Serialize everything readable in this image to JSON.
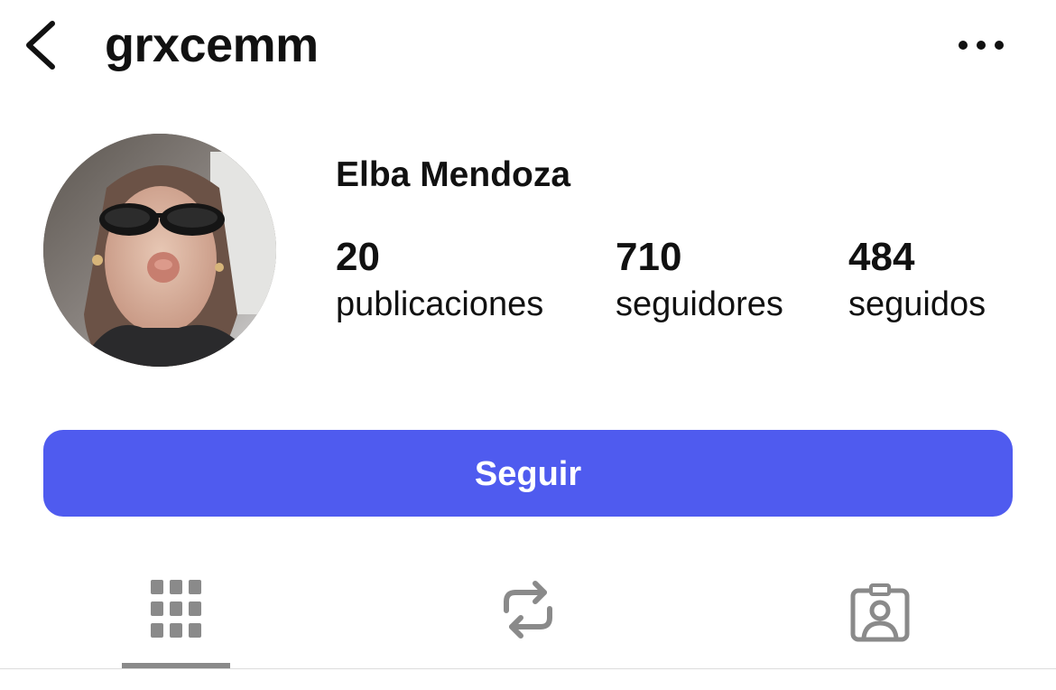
{
  "header": {
    "back_icon": "chevron-left-icon",
    "username": "grxcemm",
    "more_icon": "more-horizontal-icon"
  },
  "profile": {
    "display_name": "Elba Mendoza",
    "avatar": "profile-photo-avatar"
  },
  "stats": [
    {
      "count": "20",
      "label": "publicaciones"
    },
    {
      "count": "710",
      "label": "seguidores"
    },
    {
      "count": "484",
      "label": "seguidos"
    }
  ],
  "actions": {
    "follow_label": "Seguir",
    "follow_color": "#4f5bef"
  },
  "tabs": [
    {
      "icon": "grid-icon",
      "active": true
    },
    {
      "icon": "repost-icon",
      "active": false
    },
    {
      "icon": "tagged-icon",
      "active": false
    }
  ]
}
